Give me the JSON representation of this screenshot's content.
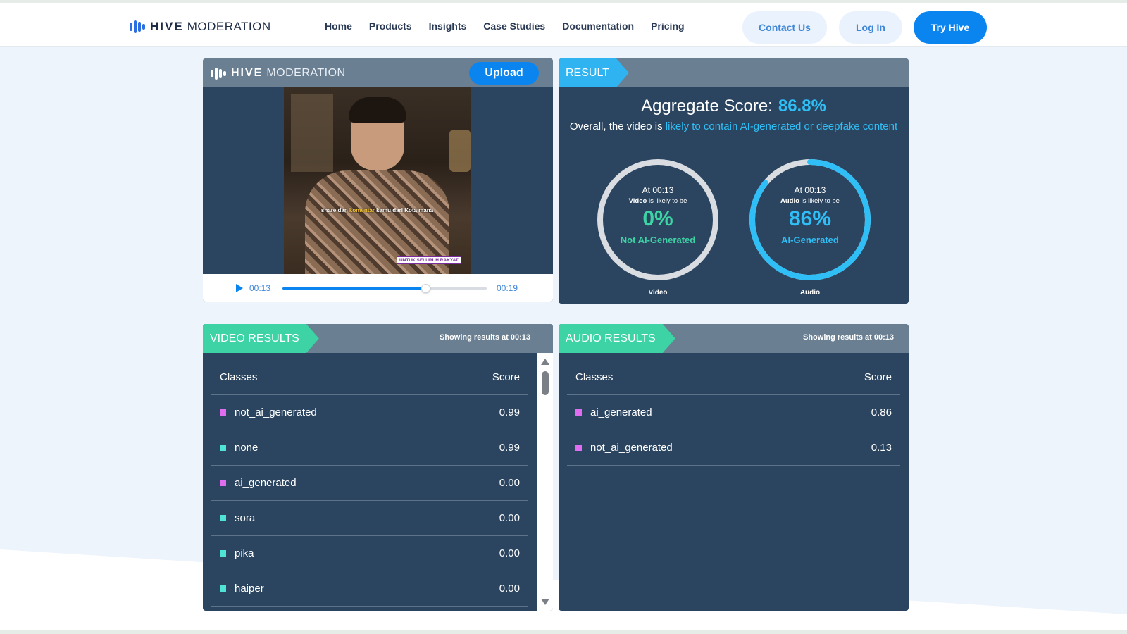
{
  "nav": {
    "brand_bold": "HIVE",
    "brand_light": "MODERATION",
    "links": [
      "Home",
      "Products",
      "Insights",
      "Case Studies",
      "Documentation",
      "Pricing"
    ],
    "contact_label": "Contact Us",
    "login_label": "Log In",
    "try_label": "Try Hive"
  },
  "player": {
    "brand_bold": "HIVE",
    "brand_light": "MODERATION",
    "upload_label": "Upload",
    "subtitle_pre": "share dan ",
    "subtitle_highlight": "komentar",
    "subtitle_post": " kamu dari Kota mana",
    "badge": "UNTUK SELURUH RAKYAT",
    "current_time": "00:13",
    "total_time": "00:19",
    "progress": 0.7
  },
  "result": {
    "ribbon": "RESULT",
    "aggregate_label": "Aggregate Score:",
    "aggregate_value": "86.8%",
    "overall_pre": "Overall, the video is ",
    "overall_link": "likely to contain AI-generated or deepfake content",
    "video_gauge": {
      "at": "At 00:13",
      "subject": "Video",
      "likely": " is likely to be",
      "percent": "0%",
      "fraction": 0.0,
      "verdict": "Not AI-Generated",
      "caption": "Video",
      "color": "#3ed3a4"
    },
    "audio_gauge": {
      "at": "At 00:13",
      "subject": "Audio",
      "likely": " is likely to be",
      "percent": "86%",
      "fraction": 0.86,
      "verdict": "AI-Generated",
      "caption": "Audio",
      "color": "#2fbff6"
    }
  },
  "video_results": {
    "ribbon": "VIDEO RESULTS",
    "showing_pre": "Showing results at ",
    "showing_time": "00:13",
    "col_classes": "Classes",
    "col_score": "Score",
    "rows": [
      {
        "label": "not_ai_generated",
        "score": "0.99",
        "color": "#e06cf0"
      },
      {
        "label": "none",
        "score": "0.99",
        "color": "#4fe3d6"
      },
      {
        "label": "ai_generated",
        "score": "0.00",
        "color": "#e06cf0"
      },
      {
        "label": "sora",
        "score": "0.00",
        "color": "#4fe3d6"
      },
      {
        "label": "pika",
        "score": "0.00",
        "color": "#4fe3d6"
      },
      {
        "label": "haiper",
        "score": "0.00",
        "color": "#4fe3d6"
      }
    ]
  },
  "audio_results": {
    "ribbon": "AUDIO RESULTS",
    "showing_pre": "Showing results at ",
    "showing_time": "00:13",
    "col_classes": "Classes",
    "col_score": "Score",
    "rows": [
      {
        "label": "ai_generated",
        "score": "0.86",
        "color": "#e06cf0"
      },
      {
        "label": "not_ai_generated",
        "score": "0.13",
        "color": "#e06cf0"
      }
    ]
  }
}
